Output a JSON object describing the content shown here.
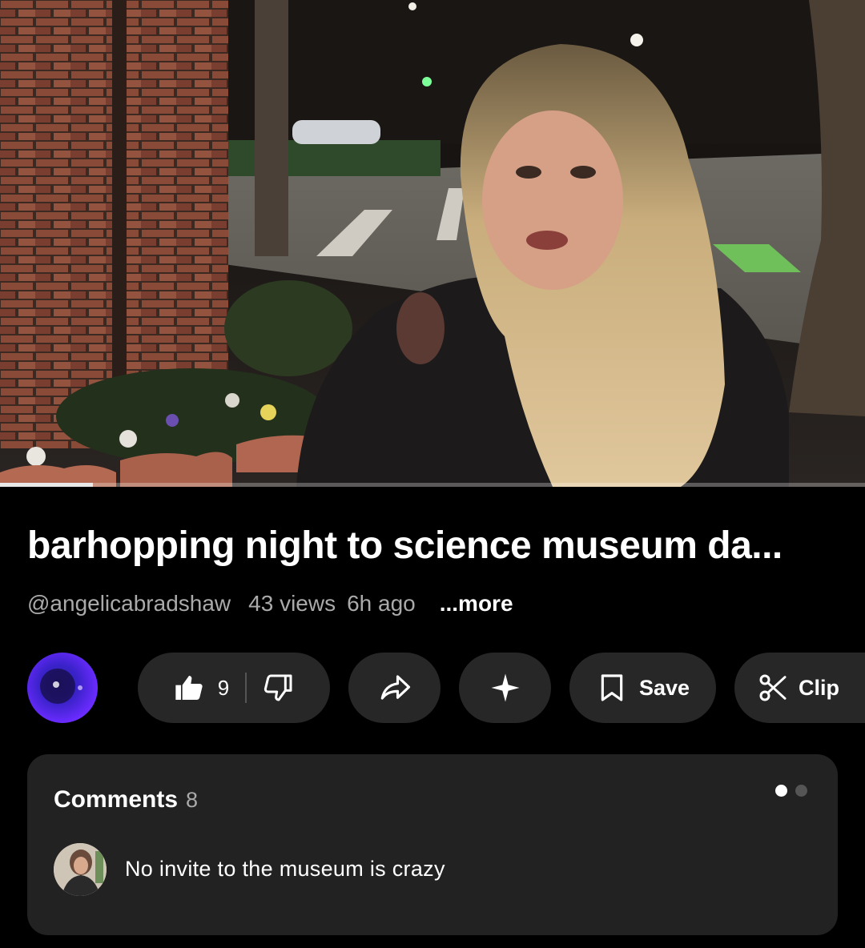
{
  "video": {
    "progress_fraction": 0.107
  },
  "video_info": {
    "title": "barhopping night to science museum da...",
    "channel": "@angelicabradshaw",
    "views": "43 views",
    "age": "6h ago",
    "more_label": "...more"
  },
  "actions": {
    "like_count": "9",
    "save_label": "Save",
    "clip_label": "Clip"
  },
  "comments": {
    "title": "Comments",
    "count": "8",
    "first_comment": "No invite to the museum is crazy"
  },
  "icons": {
    "like": "thumbs-up-icon",
    "dislike": "thumbs-down-icon",
    "share": "share-icon",
    "ai": "sparkle-icon",
    "save": "bookmark-icon",
    "clip": "scissors-icon"
  },
  "colors": {
    "background": "#000000",
    "pill": "#272727",
    "card": "#222222",
    "secondary_text": "#aaaaaa"
  }
}
